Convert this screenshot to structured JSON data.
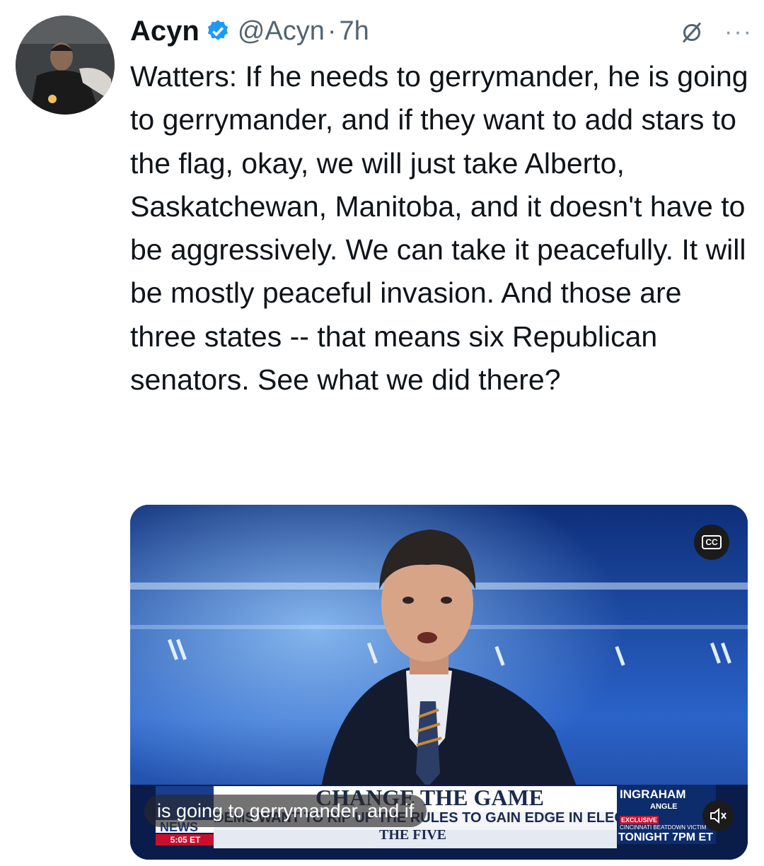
{
  "tweet": {
    "author_name": "Acyn",
    "handle": "@Acyn",
    "separator": "·",
    "time_ago": "7h",
    "text": "Watters: If he needs to gerrymander, he is going to gerrymander, and if they want to add stars to the flag, okay, we will just take Alberto, Saskatchewan, Manitoba, and it doesn't have to be aggressively. We can take it peacefully. It will be mostly peaceful invasion. And those are three states -- that means six Republican senators. See what we did there?",
    "more_icon": "···"
  },
  "video": {
    "cc_label": "CC",
    "caption": "is going to gerrymander, and if",
    "headline_top": "CHANGE THE GAME",
    "headline_sub": "DEMS WANT TO RIP UP THE RULES TO GAIN EDGE IN ELECTIONS",
    "show_name": "THE FIVE",
    "time_badge": "5:05 ET",
    "network": "NEWS",
    "promo_title": "INGRAHAM",
    "promo_sub": "ANGLE",
    "promo_exclusive": "EXCLUSIVE",
    "promo_line": "CINCINNATI BEATDOWN VICTIM",
    "promo_tonight": "TONIGHT 7PM ET"
  },
  "colors": {
    "verified_blue": "#1d9bf0",
    "text_primary": "#0f1419",
    "text_secondary": "#536471",
    "fox_red": "#c8102e",
    "fox_navy": "#0d2c6b"
  }
}
